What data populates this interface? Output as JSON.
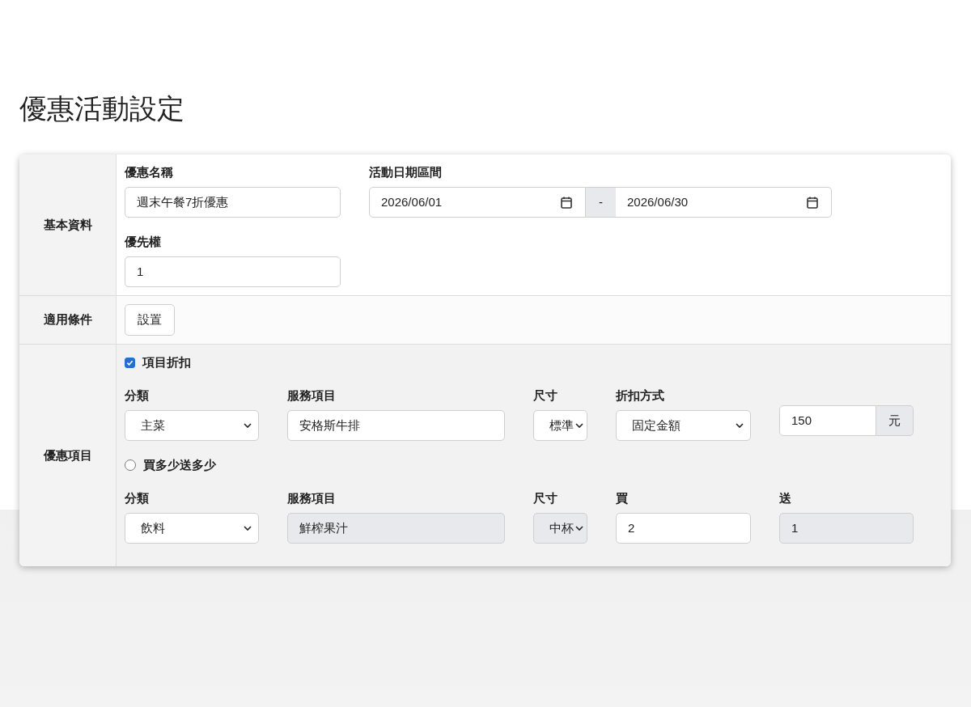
{
  "title": "優惠活動設定",
  "basic_info": {
    "label": "基本資料",
    "name": {
      "label": "優惠名稱",
      "value": "週末午餐7折優惠"
    },
    "date_range": {
      "label": "活動日期區間",
      "start": "2026/06/01",
      "separator": "-",
      "end": "2026/06/30"
    },
    "priority": {
      "label": "優先權",
      "value": "1"
    }
  },
  "conditions": {
    "label": "適用條件",
    "button": "設置"
  },
  "discount_items": {
    "label": "優惠項目",
    "item_discount": {
      "label": "項目折扣",
      "checked": true,
      "fields": [
        {
          "kind": "select",
          "label": "分類",
          "value": "主菜",
          "disabled": false
        },
        {
          "kind": "input",
          "label": "服務項目",
          "value": "安格斯牛排",
          "disabled": false
        },
        {
          "kind": "select",
          "label": "尺寸",
          "value": "標準",
          "disabled": false
        },
        {
          "kind": "select",
          "label": "折扣方式",
          "value": "固定金額",
          "disabled": false
        },
        {
          "kind": "addon_input",
          "value": "150",
          "addon": "元",
          "disabled": false
        }
      ]
    },
    "buy_get": {
      "label": "買多少送多少",
      "selected": false,
      "fields": [
        {
          "kind": "select",
          "label": "分類",
          "value": "飲料",
          "disabled": false
        },
        {
          "kind": "input",
          "label": "服務項目",
          "value": "鮮榨果汁",
          "disabled": true
        },
        {
          "kind": "select",
          "label": "尺寸",
          "value": "中杯",
          "disabled": true
        },
        {
          "kind": "input",
          "label": "買",
          "value": "2",
          "disabled": false
        },
        {
          "kind": "input",
          "label": "送",
          "value": "1",
          "disabled": true
        }
      ]
    }
  }
}
